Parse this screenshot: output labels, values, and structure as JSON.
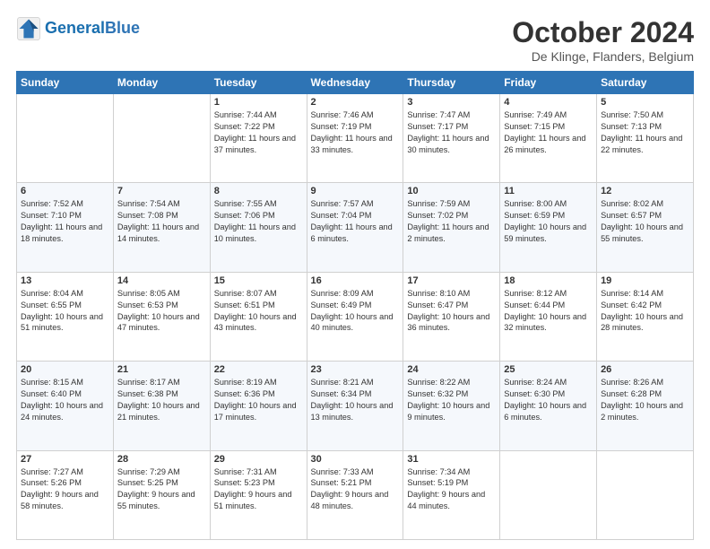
{
  "logo": {
    "line1": "General",
    "line2": "Blue"
  },
  "header": {
    "month": "October 2024",
    "location": "De Klinge, Flanders, Belgium"
  },
  "days_of_week": [
    "Sunday",
    "Monday",
    "Tuesday",
    "Wednesday",
    "Thursday",
    "Friday",
    "Saturday"
  ],
  "weeks": [
    [
      {
        "day": "",
        "sunrise": "",
        "sunset": "",
        "daylight": ""
      },
      {
        "day": "",
        "sunrise": "",
        "sunset": "",
        "daylight": ""
      },
      {
        "day": "1",
        "sunrise": "Sunrise: 7:44 AM",
        "sunset": "Sunset: 7:22 PM",
        "daylight": "Daylight: 11 hours and 37 minutes."
      },
      {
        "day": "2",
        "sunrise": "Sunrise: 7:46 AM",
        "sunset": "Sunset: 7:19 PM",
        "daylight": "Daylight: 11 hours and 33 minutes."
      },
      {
        "day": "3",
        "sunrise": "Sunrise: 7:47 AM",
        "sunset": "Sunset: 7:17 PM",
        "daylight": "Daylight: 11 hours and 30 minutes."
      },
      {
        "day": "4",
        "sunrise": "Sunrise: 7:49 AM",
        "sunset": "Sunset: 7:15 PM",
        "daylight": "Daylight: 11 hours and 26 minutes."
      },
      {
        "day": "5",
        "sunrise": "Sunrise: 7:50 AM",
        "sunset": "Sunset: 7:13 PM",
        "daylight": "Daylight: 11 hours and 22 minutes."
      }
    ],
    [
      {
        "day": "6",
        "sunrise": "Sunrise: 7:52 AM",
        "sunset": "Sunset: 7:10 PM",
        "daylight": "Daylight: 11 hours and 18 minutes."
      },
      {
        "day": "7",
        "sunrise": "Sunrise: 7:54 AM",
        "sunset": "Sunset: 7:08 PM",
        "daylight": "Daylight: 11 hours and 14 minutes."
      },
      {
        "day": "8",
        "sunrise": "Sunrise: 7:55 AM",
        "sunset": "Sunset: 7:06 PM",
        "daylight": "Daylight: 11 hours and 10 minutes."
      },
      {
        "day": "9",
        "sunrise": "Sunrise: 7:57 AM",
        "sunset": "Sunset: 7:04 PM",
        "daylight": "Daylight: 11 hours and 6 minutes."
      },
      {
        "day": "10",
        "sunrise": "Sunrise: 7:59 AM",
        "sunset": "Sunset: 7:02 PM",
        "daylight": "Daylight: 11 hours and 2 minutes."
      },
      {
        "day": "11",
        "sunrise": "Sunrise: 8:00 AM",
        "sunset": "Sunset: 6:59 PM",
        "daylight": "Daylight: 10 hours and 59 minutes."
      },
      {
        "day": "12",
        "sunrise": "Sunrise: 8:02 AM",
        "sunset": "Sunset: 6:57 PM",
        "daylight": "Daylight: 10 hours and 55 minutes."
      }
    ],
    [
      {
        "day": "13",
        "sunrise": "Sunrise: 8:04 AM",
        "sunset": "Sunset: 6:55 PM",
        "daylight": "Daylight: 10 hours and 51 minutes."
      },
      {
        "day": "14",
        "sunrise": "Sunrise: 8:05 AM",
        "sunset": "Sunset: 6:53 PM",
        "daylight": "Daylight: 10 hours and 47 minutes."
      },
      {
        "day": "15",
        "sunrise": "Sunrise: 8:07 AM",
        "sunset": "Sunset: 6:51 PM",
        "daylight": "Daylight: 10 hours and 43 minutes."
      },
      {
        "day": "16",
        "sunrise": "Sunrise: 8:09 AM",
        "sunset": "Sunset: 6:49 PM",
        "daylight": "Daylight: 10 hours and 40 minutes."
      },
      {
        "day": "17",
        "sunrise": "Sunrise: 8:10 AM",
        "sunset": "Sunset: 6:47 PM",
        "daylight": "Daylight: 10 hours and 36 minutes."
      },
      {
        "day": "18",
        "sunrise": "Sunrise: 8:12 AM",
        "sunset": "Sunset: 6:44 PM",
        "daylight": "Daylight: 10 hours and 32 minutes."
      },
      {
        "day": "19",
        "sunrise": "Sunrise: 8:14 AM",
        "sunset": "Sunset: 6:42 PM",
        "daylight": "Daylight: 10 hours and 28 minutes."
      }
    ],
    [
      {
        "day": "20",
        "sunrise": "Sunrise: 8:15 AM",
        "sunset": "Sunset: 6:40 PM",
        "daylight": "Daylight: 10 hours and 24 minutes."
      },
      {
        "day": "21",
        "sunrise": "Sunrise: 8:17 AM",
        "sunset": "Sunset: 6:38 PM",
        "daylight": "Daylight: 10 hours and 21 minutes."
      },
      {
        "day": "22",
        "sunrise": "Sunrise: 8:19 AM",
        "sunset": "Sunset: 6:36 PM",
        "daylight": "Daylight: 10 hours and 17 minutes."
      },
      {
        "day": "23",
        "sunrise": "Sunrise: 8:21 AM",
        "sunset": "Sunset: 6:34 PM",
        "daylight": "Daylight: 10 hours and 13 minutes."
      },
      {
        "day": "24",
        "sunrise": "Sunrise: 8:22 AM",
        "sunset": "Sunset: 6:32 PM",
        "daylight": "Daylight: 10 hours and 9 minutes."
      },
      {
        "day": "25",
        "sunrise": "Sunrise: 8:24 AM",
        "sunset": "Sunset: 6:30 PM",
        "daylight": "Daylight: 10 hours and 6 minutes."
      },
      {
        "day": "26",
        "sunrise": "Sunrise: 8:26 AM",
        "sunset": "Sunset: 6:28 PM",
        "daylight": "Daylight: 10 hours and 2 minutes."
      }
    ],
    [
      {
        "day": "27",
        "sunrise": "Sunrise: 7:27 AM",
        "sunset": "Sunset: 5:26 PM",
        "daylight": "Daylight: 9 hours and 58 minutes."
      },
      {
        "day": "28",
        "sunrise": "Sunrise: 7:29 AM",
        "sunset": "Sunset: 5:25 PM",
        "daylight": "Daylight: 9 hours and 55 minutes."
      },
      {
        "day": "29",
        "sunrise": "Sunrise: 7:31 AM",
        "sunset": "Sunset: 5:23 PM",
        "daylight": "Daylight: 9 hours and 51 minutes."
      },
      {
        "day": "30",
        "sunrise": "Sunrise: 7:33 AM",
        "sunset": "Sunset: 5:21 PM",
        "daylight": "Daylight: 9 hours and 48 minutes."
      },
      {
        "day": "31",
        "sunrise": "Sunrise: 7:34 AM",
        "sunset": "Sunset: 5:19 PM",
        "daylight": "Daylight: 9 hours and 44 minutes."
      },
      {
        "day": "",
        "sunrise": "",
        "sunset": "",
        "daylight": ""
      },
      {
        "day": "",
        "sunrise": "",
        "sunset": "",
        "daylight": ""
      }
    ]
  ]
}
